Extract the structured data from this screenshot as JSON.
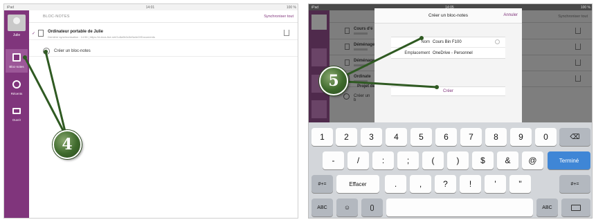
{
  "left_screen": {
    "status": {
      "device": "iPad",
      "time": "14:01",
      "battery": "100 %"
    },
    "sidebar": {
      "user_name": "Julie",
      "items": [
        {
          "label": "Bloc-notes",
          "icon": "notebook-icon",
          "active": true
        },
        {
          "label": "Récents",
          "icon": "clock-icon",
          "active": false
        },
        {
          "label": "Ouvrir",
          "icon": "folder-icon",
          "active": false
        }
      ]
    },
    "header": {
      "title": "BLOC-NOTES",
      "sync_label": "Synchroniser tout"
    },
    "notebook": {
      "name": "Ordinateur portable de Julie",
      "details": "Dernière synchronisation : 14:56 | https://d.docs.live.net/1c8a9b0c5d3a4e2f/Documents"
    },
    "create_label": "Créer un bloc-notes"
  },
  "right_screen": {
    "status": {
      "device": "iPad",
      "time": "14:05",
      "battery": "100 %"
    },
    "sync_label": "Synchroniser tout",
    "list_items": [
      "Cours d'é",
      "Déménage",
      "Déménage",
      "Ordinate",
      "Projet de"
    ],
    "create_label": "Créer un b",
    "dialog": {
      "title": "Créer un bloc-notes",
      "cancel_label": "Annuler",
      "name_label": "Nom",
      "name_value": "Cours Bin F100",
      "location_label": "Emplacement",
      "location_value": "OneDrive - Personnel",
      "create_button": "Créer"
    },
    "keyboard": {
      "row1": [
        "1",
        "2",
        "3",
        "4",
        "5",
        "6",
        "7",
        "8",
        "9",
        "0"
      ],
      "row2": [
        "-",
        "/",
        ":",
        ";",
        "(",
        ")",
        "$",
        "&",
        "@"
      ],
      "done_label": "Terminé",
      "row3_shift": "#+=",
      "undo_label": "Effacer",
      "row3": [
        ".",
        ",",
        "?",
        "!",
        "'",
        "\""
      ],
      "abc_label": "ABC"
    }
  },
  "callouts": {
    "step_a": "4",
    "step_b": "5"
  },
  "colors": {
    "accent": "#80357c",
    "callout": "#3e6a2c",
    "done_key": "#3f86d6"
  }
}
